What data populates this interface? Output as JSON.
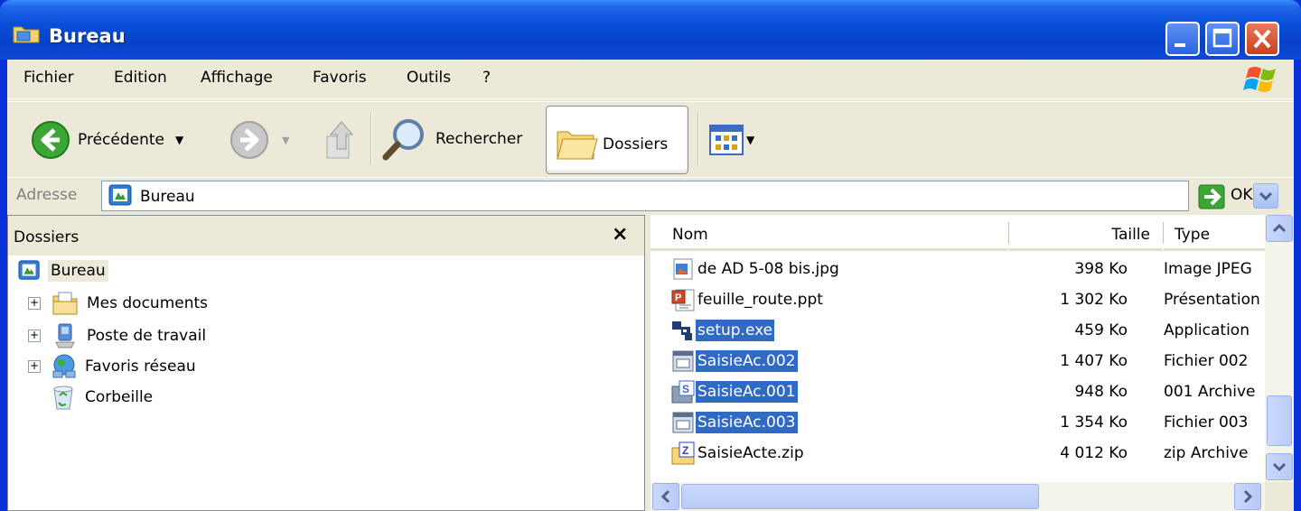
{
  "window": {
    "title": "Bureau"
  },
  "menu": [
    "Fichier",
    "Edition",
    "Affichage",
    "Favoris",
    "Outils",
    "?"
  ],
  "toolbar": {
    "back_label": "Précédente",
    "search_label": "Rechercher",
    "folders_label": "Dossiers"
  },
  "address": {
    "label": "Adresse",
    "value": "Bureau",
    "go_label": "OK"
  },
  "folders_pane": {
    "title": "Dossiers",
    "close": "×",
    "tree": [
      {
        "label": "Bureau",
        "icon": "desktop-icon"
      },
      {
        "label": "Mes documents",
        "icon": "my-documents-icon"
      },
      {
        "label": "Poste de travail",
        "icon": "my-computer-icon"
      },
      {
        "label": "Favoris réseau",
        "icon": "network-places-icon"
      },
      {
        "label": "Corbeille",
        "icon": "recycle-bin-icon"
      }
    ]
  },
  "list": {
    "columns": {
      "name": "Nom",
      "size": "Taille",
      "type": "Type"
    },
    "rows": [
      {
        "name": "de AD 5-08 bis.jpg",
        "size": "398 Ko",
        "type": "Image JPEG",
        "selected": false,
        "icon": "jpeg-file-icon"
      },
      {
        "name": "feuille_route.ppt",
        "size": "1 302 Ko",
        "type": "Présentation",
        "selected": false,
        "icon": "powerpoint-file-icon"
      },
      {
        "name": "setup.exe",
        "size": "459 Ko",
        "type": "Application",
        "selected": true,
        "icon": "exe-file-icon"
      },
      {
        "name": "SaisieAc.002",
        "size": "1 407 Ko",
        "type": "Fichier 002",
        "selected": true,
        "icon": "generic-file-icon"
      },
      {
        "name": "SaisieAc.001",
        "size": "948 Ko",
        "type": "001 Archive",
        "selected": true,
        "icon": "archive-file-icon"
      },
      {
        "name": "SaisieAc.003",
        "size": "1 354 Ko",
        "type": "Fichier 003",
        "selected": true,
        "icon": "generic-file-icon"
      },
      {
        "name": "SaisieActe.zip",
        "size": "4 012 Ko",
        "type": "zip Archive",
        "selected": false,
        "icon": "zip-file-icon"
      }
    ]
  },
  "colors": {
    "title_blue": "#0A4FD9",
    "selection": "#316AC5",
    "chrome": "#ECE9D8"
  }
}
